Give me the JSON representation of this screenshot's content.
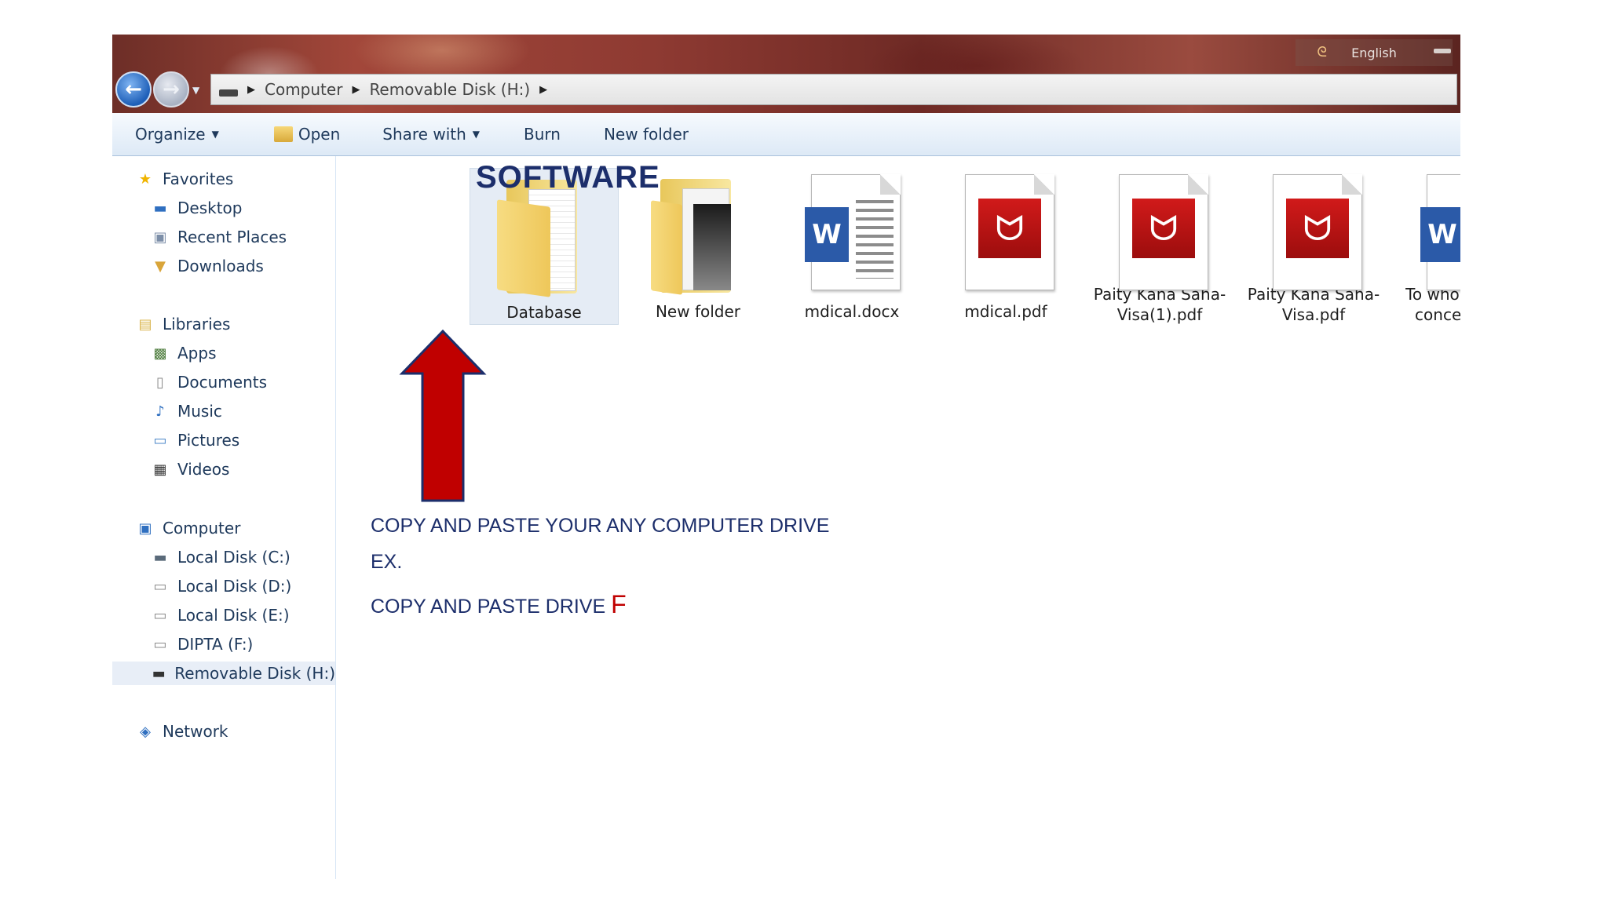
{
  "window": {
    "nav": {
      "back_glyph": "⮌",
      "forward_glyph": "⮎"
    },
    "address": {
      "crumbs": [
        "Computer",
        "Removable Disk (H:)"
      ],
      "separator": "▸"
    },
    "language_bar": {
      "label": "English"
    }
  },
  "toolbar": {
    "organize": "Organize",
    "open": "Open",
    "share_with": "Share with",
    "burn": "Burn",
    "new_folder": "New folder"
  },
  "sidebar": {
    "favorites": {
      "label": "Favorites",
      "items": [
        "Desktop",
        "Recent Places",
        "Downloads"
      ]
    },
    "libraries": {
      "label": "Libraries",
      "items": [
        "Apps",
        "Documents",
        "Music",
        "Pictures",
        "Videos"
      ]
    },
    "computer": {
      "label": "Computer",
      "items": [
        "Local Disk (C:)",
        "Local Disk (D:)",
        "Local Disk (E:)",
        "DIPTA (F:)",
        "Removable Disk (H:)"
      ],
      "selected": "Removable Disk (H:)"
    },
    "network": {
      "label": "Network"
    }
  },
  "files": [
    {
      "name": "Database",
      "type": "folder",
      "selected": true
    },
    {
      "name": "New folder",
      "type": "folder"
    },
    {
      "name": "mdical.docx",
      "type": "word"
    },
    {
      "name": "mdical.pdf",
      "type": "pdf"
    },
    {
      "name": "Paity Kana Saha-Visa(1).pdf",
      "line1": "Paity Kana Saha-",
      "line2": "Visa(1).pdf",
      "type": "pdf"
    },
    {
      "name": "Paity Kana Saha-Visa.pdf",
      "line1": "Paity Kana Saha-",
      "line2": "Visa.pdf",
      "type": "pdf"
    },
    {
      "name": "To whom it may concern.docx",
      "line1": "To whom it may",
      "line2": "concern.docx",
      "type": "word"
    }
  ],
  "overlay": {
    "title": "SOFTWARE",
    "line1": "COPY AND PASTE YOUR ANY COMPUTER DRIVE",
    "line2": "EX.",
    "line3": "COPY AND PASTE DRIVE",
    "drive_letter": "F",
    "arrow_color": "#c00000"
  },
  "colors": {
    "selection": "#e5ecf5",
    "toolbar_text": "#1e395b",
    "annotation_text": "#1c2e6b",
    "pdf_red": "#d11a1a",
    "word_blue": "#2b5aa8"
  },
  "icons": {
    "favorites": "star-icon",
    "libraries": "library-icon",
    "computer": "computer-icon",
    "network": "network-icon",
    "drive": "drive-icon"
  }
}
